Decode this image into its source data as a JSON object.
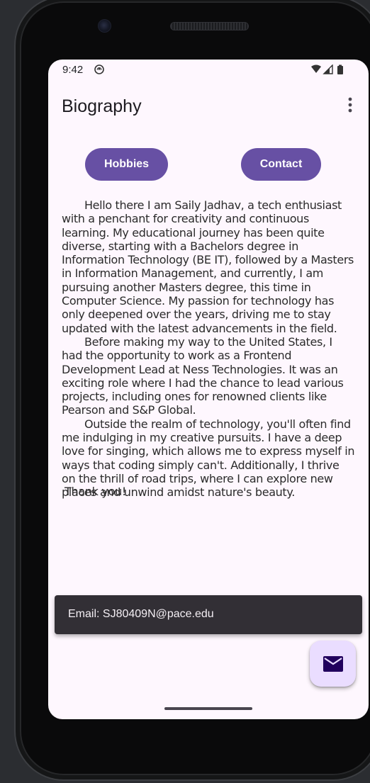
{
  "status_bar": {
    "time": "9:42",
    "app_icon": "android-notification-icon",
    "icons": [
      "wifi-icon",
      "signal-icon",
      "battery-icon"
    ]
  },
  "app_bar": {
    "title": "Biography",
    "menu_icon": "more-vert-icon"
  },
  "buttons": {
    "hobbies": "Hobbies",
    "contact": "Contact"
  },
  "bio": {
    "paragraphs": [
      "Hello there I am Saily Jadhav, a tech enthusiast with a penchant for creativity and continuous learning. My educational journey has been quite diverse, starting with a Bachelors degree in Information Technology (BE IT), followed by a Masters in Information Management, and currently, I am pursuing another Masters degree, this time in Computer Science. My passion for technology has only deepened over the years, driving me to stay updated with the latest advancements in the field.",
      "Before making my way to the United States, I had the opportunity to work as a Frontend Development Lead at Ness Technologies. It was an exciting role where I had the chance to lead various projects, including ones for renowned clients like Pearson and S&P Global.",
      "Outside the realm of technology, you'll often find me indulging in my creative pursuits. I have a deep love for singing, which allows me to express myself in ways that coding simply can't. Additionally, I thrive on the thrill of road trips, where I can explore new places and unwind amidst nature's beauty."
    ],
    "closing": "Thank you!"
  },
  "snackbar": {
    "text": "Email: SJ80409N@pace.edu"
  },
  "fab": {
    "icon": "email-icon"
  },
  "colors": {
    "primary": "#6750a4",
    "surface": "#fef7fe",
    "fab_container": "#eaddff",
    "snackbar_bg": "#322f35"
  }
}
